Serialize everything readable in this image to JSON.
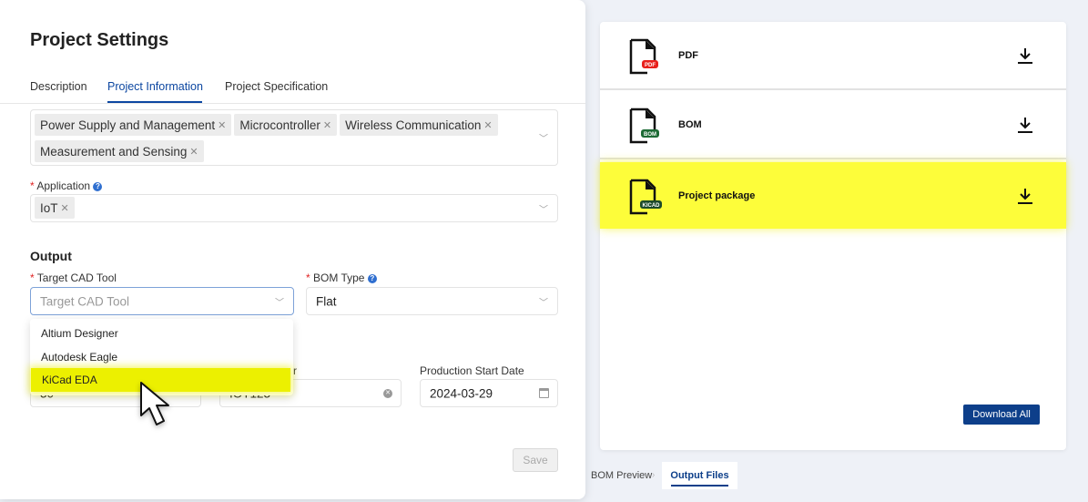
{
  "settings": {
    "title": "Project Settings",
    "tabs": [
      {
        "label": "Description"
      },
      {
        "label": "Project Information"
      },
      {
        "label": "Project Specification"
      }
    ],
    "categories": [
      "Power Supply and Management",
      "Microcontroller",
      "Wireless Communication",
      "Measurement and Sensing"
    ],
    "application": {
      "label": "Application",
      "tags": [
        "IoT"
      ]
    },
    "output_heading": "Output",
    "cad_tool": {
      "label": "Target CAD Tool",
      "placeholder": "Target CAD Tool",
      "options": [
        "Altium Designer",
        "Autodesk Eagle",
        "KiCad EDA"
      ],
      "highlighted": "KiCad EDA"
    },
    "bom_type": {
      "label": "BOM Type",
      "value": "Flat"
    },
    "field1": {
      "value": "30"
    },
    "field2": {
      "label_fragment": "r",
      "value": "IOT123"
    },
    "production": {
      "label": "Production Start Date",
      "value": "2024-03-29"
    },
    "save_label": "Save"
  },
  "files": {
    "items": [
      {
        "name": "PDF",
        "badge": "PDF",
        "badge_color": "#e8201c"
      },
      {
        "name": "BOM",
        "badge": "BOM",
        "badge_color": "#1d6b35"
      },
      {
        "name": "Project package",
        "badge": "KICAD",
        "badge_color": "#1d4a2a",
        "highlighted": true
      }
    ],
    "download_all": "Download All",
    "bottom_tabs": [
      {
        "label": "BOM Preview"
      },
      {
        "label": "Output Files",
        "active": true
      }
    ]
  },
  "colors": {
    "accent": "#0d47a1",
    "highlight": "#fdfd3a",
    "button": "#0d3f8a"
  }
}
